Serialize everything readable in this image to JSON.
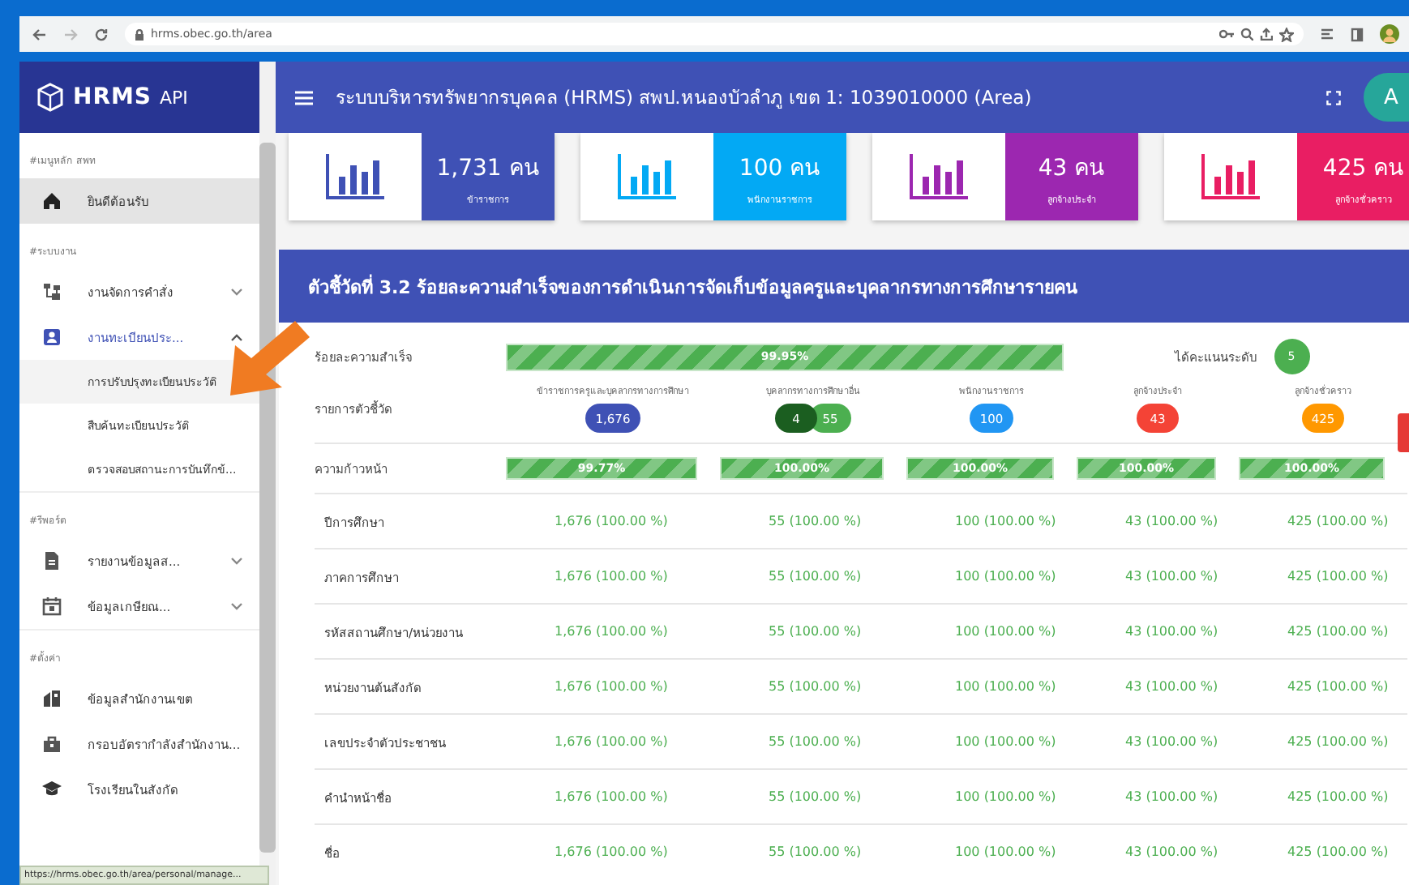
{
  "browser": {
    "url": "hrms.obec.go.th/area"
  },
  "sidebar": {
    "logo": "HRMS",
    "logo_suffix": "API",
    "items": [
      {
        "kind": "heading",
        "label": "#เมนูหลัก สพท"
      },
      {
        "kind": "item",
        "label": "ยินดีต้อนรับ",
        "selected": true
      },
      {
        "kind": "heading",
        "label": "#ระบบงาน"
      },
      {
        "kind": "item",
        "label": "งานจัดการคำสั่ง",
        "selected": false,
        "expanded": false
      },
      {
        "kind": "item",
        "label": "งานทะเบียนประ...",
        "selected": false,
        "expanded": true
      },
      {
        "kind": "subitem",
        "label": "การปรับปรุงทะเบียนประวัติ",
        "selected": true
      },
      {
        "kind": "subitem",
        "label": "สืบค้นทะเบียนประวัติ",
        "selected": false
      },
      {
        "kind": "subitem",
        "label": "ตรวจสอบสถานะการบันทึกข้...",
        "selected": false
      },
      {
        "kind": "heading",
        "label": "#รีพอร์ต"
      },
      {
        "kind": "item",
        "label": "รายงานข้อมูลส...",
        "selected": false,
        "expanded": false
      },
      {
        "kind": "item",
        "label": "ข้อมูลเกษียณ...",
        "selected": false,
        "expanded": false
      },
      {
        "kind": "heading",
        "label": "#ตั้งค่า"
      },
      {
        "kind": "item",
        "label": "ข้อมูลสำนักงานเขต",
        "selected": false
      },
      {
        "kind": "item",
        "label": "กรอบอัตรากำลังสำนักงาน...",
        "selected": false
      },
      {
        "kind": "item",
        "label": "โรงเรียนในสังกัด",
        "selected": false
      }
    ]
  },
  "status_url": "https://hrms.obec.go.th/area/personal/manage...",
  "header": {
    "title": "ระบบบริหารทรัพยากรบุคคล (HRMS) สพป.หนองบัวลำภู เขต 1: 1039010000 (Area)",
    "avatar": "A"
  },
  "stat_cards": [
    {
      "value": "1,731 คน",
      "label": "ข้าราชการ",
      "color": "#3f51b5"
    },
    {
      "value": "100 คน",
      "label": "พนักงานราชการ",
      "color": "#03a9f4"
    },
    {
      "value": "43 คน",
      "label": "ลูกจ้างประจำ",
      "color": "#9c27b0"
    },
    {
      "value": "425 คน",
      "label": "ลูกจ้างชั่วคราว",
      "color": "#e91e63"
    }
  ],
  "kpi": {
    "title": "ตัวชี้วัดที่ 3.2 ร้อยละความสำเร็จของการดำเนินการจัดเก็บข้อมูลครูและบุคลากรทางการศึกษารายคน",
    "success": {
      "label": "ร้อยละความสำเร็จ",
      "reading": "99.95%",
      "level": 0.9995
    },
    "score": {
      "label": "ได้คะแนนระดับ",
      "value": "5"
    },
    "indicator_label": "รายการตัวชี้วัด",
    "columns": [
      {
        "name": "ข้าราชการครูและบุคลากรทางการศึกษา",
        "badges": [
          {
            "text": "1,676",
            "color": "#3f51b5"
          }
        ]
      },
      {
        "name": "บุคลากรทางการศึกษาอื่น",
        "badges": [
          {
            "text": "4",
            "color": "#1b5e20"
          },
          {
            "text": "55",
            "color": "#4caf50"
          }
        ]
      },
      {
        "name": "พนักงานราชการ",
        "badges": [
          {
            "text": "100",
            "color": "#2196f3"
          }
        ]
      },
      {
        "name": "ลูกจ้างประจำ",
        "badges": [
          {
            "text": "43",
            "color": "#f44336"
          }
        ]
      },
      {
        "name": "ลูกจ้างชั่วคราว",
        "badges": [
          {
            "text": "425",
            "color": "#ff9800"
          }
        ]
      }
    ],
    "progress_label": "ความก้าวหน้า",
    "progress": [
      {
        "reading": "99.77%",
        "level": 0.9977
      },
      {
        "reading": "100.00%",
        "level": 1
      },
      {
        "reading": "100.00%",
        "level": 1
      },
      {
        "reading": "100.00%",
        "level": 1
      },
      {
        "reading": "100.00%",
        "level": 1
      }
    ],
    "rows": [
      {
        "label": "ปีการศึกษา",
        "cells": [
          "1,676 (100.00 %)",
          "55 (100.00 %)",
          "100 (100.00 %)",
          "43 (100.00 %)",
          "425 (100.00 %)"
        ]
      },
      {
        "label": "ภาคการศึกษา",
        "cells": [
          "1,676 (100.00 %)",
          "55 (100.00 %)",
          "100 (100.00 %)",
          "43 (100.00 %)",
          "425 (100.00 %)"
        ]
      },
      {
        "label": "รหัสสถานศึกษา/หน่วยงาน",
        "cells": [
          "1,676 (100.00 %)",
          "55 (100.00 %)",
          "100 (100.00 %)",
          "43 (100.00 %)",
          "425 (100.00 %)"
        ]
      },
      {
        "label": "หน่วยงานต้นสังกัด",
        "cells": [
          "1,676 (100.00 %)",
          "55 (100.00 %)",
          "100 (100.00 %)",
          "43 (100.00 %)",
          "425 (100.00 %)"
        ]
      },
      {
        "label": "เลขประจำตัวประชาชน",
        "cells": [
          "1,676 (100.00 %)",
          "55 (100.00 %)",
          "100 (100.00 %)",
          "43 (100.00 %)",
          "425 (100.00 %)"
        ]
      },
      {
        "label": "คำนำหน้าชื่อ",
        "cells": [
          "1,676 (100.00 %)",
          "55 (100.00 %)",
          "100 (100.00 %)",
          "43 (100.00 %)",
          "425 (100.00 %)"
        ]
      },
      {
        "label": "ชื่อ",
        "cells": [
          "1,676 (100.00 %)",
          "55 (100.00 %)",
          "100 (100.00 %)",
          "43 (100.00 %)",
          "425 (100.00 %)"
        ]
      }
    ]
  }
}
